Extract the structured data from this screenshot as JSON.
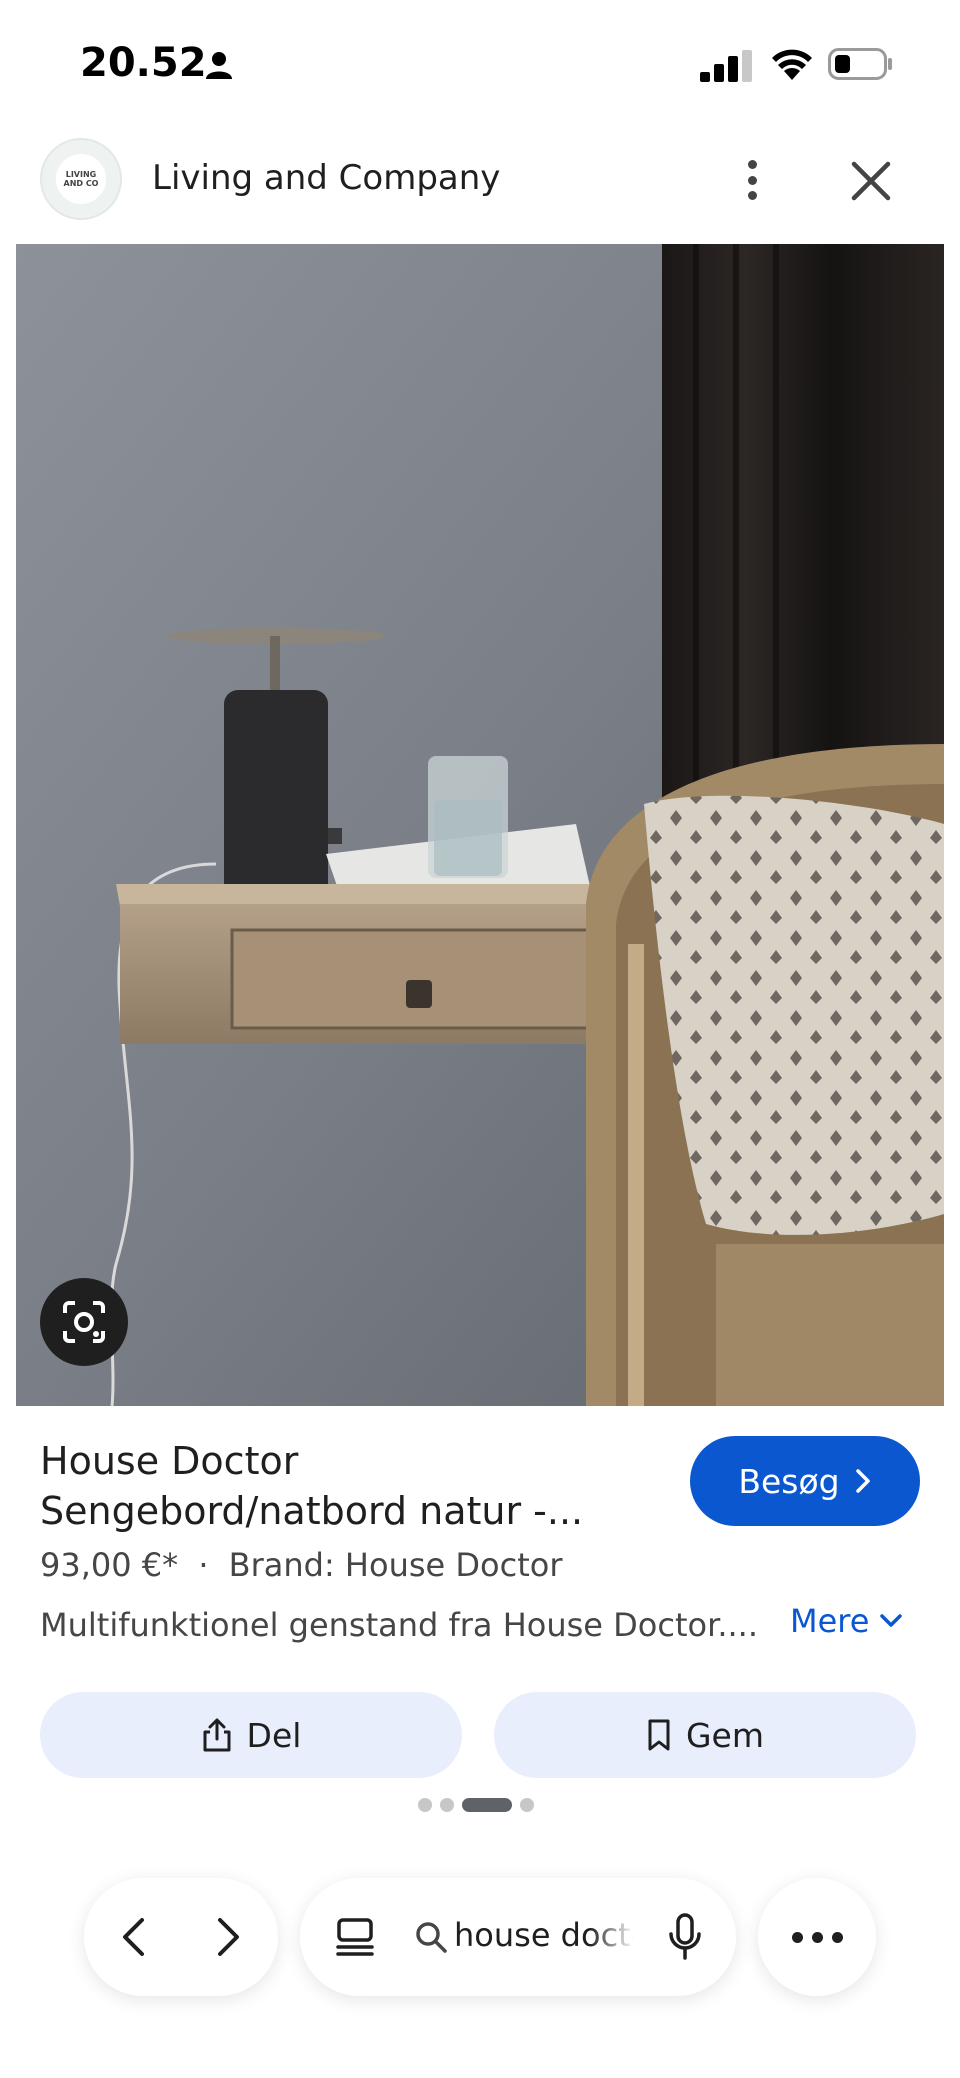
{
  "status_bar": {
    "time": "20.52"
  },
  "header": {
    "site_name": "Living and Company",
    "logo_text": "LIVING AND CO"
  },
  "colors": {
    "accent": "#0b57d0",
    "chip_bg": "#e8eefc",
    "text_primary": "#1f1f1f",
    "text_secondary": "#444746"
  },
  "product": {
    "title": "House Doctor Sengebord/natbord natur -...",
    "price": "93,00 €*",
    "separator": "·",
    "brand": "Brand: House Doctor",
    "description": "Multifunktionel genstand fra House Doctor....",
    "visit_label": "Besøg",
    "more_label": "Mere"
  },
  "actions": {
    "share_label": "Del",
    "save_label": "Gem"
  },
  "pagination": {
    "total": 4,
    "active_index": 3
  },
  "bottom_bar": {
    "search_query": "house doctor"
  },
  "icons": [
    "person-icon",
    "signal-icon",
    "wifi-icon",
    "battery-icon",
    "more-vert-icon",
    "close-icon",
    "lens-icon",
    "chevron-right-icon",
    "chevron-down-icon",
    "share-icon",
    "bookmark-icon",
    "back-icon",
    "forward-icon",
    "tabs-icon",
    "search-icon",
    "mic-icon",
    "more-horiz-icon"
  ]
}
